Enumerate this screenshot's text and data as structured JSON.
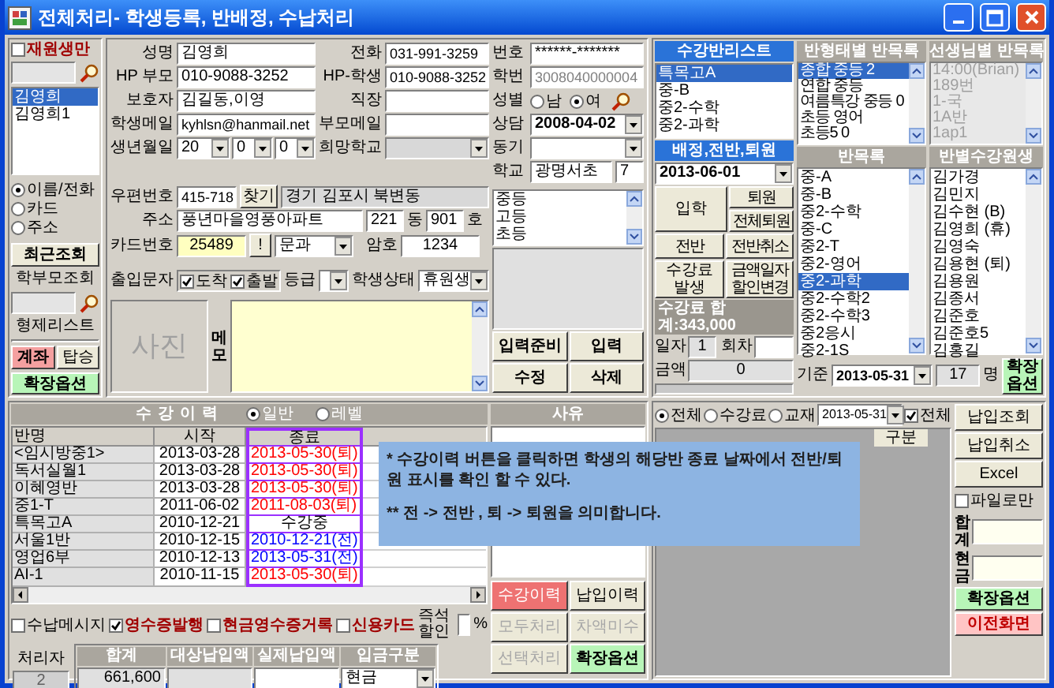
{
  "window": {
    "title": "전체처리- 학생등록, 반배정, 수납처리"
  },
  "sidebar": {
    "enrolled_only": {
      "label": "재원생만",
      "checked": false
    },
    "student_list": [
      {
        "label": "김영희",
        "selected": true
      },
      {
        "label": "김영희1",
        "selected": false
      }
    ],
    "search_modes": [
      {
        "label": "이름/전화",
        "selected": true
      },
      {
        "label": "카드",
        "selected": false
      },
      {
        "label": "주소",
        "selected": false
      }
    ],
    "recent_button": "최근조회",
    "parent_search_label": "학부모조회",
    "sibling_list_label": "형제리스트",
    "buttons": [
      {
        "label": "계좌",
        "kind": "accent"
      },
      {
        "label": "탑승",
        "kind": "plain"
      }
    ],
    "extend_button": "확장옵션"
  },
  "student_form": {
    "name": {
      "label": "성명",
      "value": "김영희"
    },
    "phone": {
      "label": "전화",
      "value": "031-991-3259"
    },
    "id_number": {
      "label": "번호",
      "value": "******-*******"
    },
    "parent_hp": {
      "label": "HP 부모",
      "value": "010-9088-3252"
    },
    "student_hp": {
      "label": "HP-학생",
      "value": "010-9088-3252"
    },
    "student_no": {
      "label": "학번",
      "value": "3008040000004",
      "disabled": true
    },
    "guardian": {
      "label": "보호자",
      "value": "김길동,이영"
    },
    "workplace": {
      "label": "직장"
    },
    "gender": {
      "label": "성별",
      "options": [
        {
          "label": "남",
          "selected": false
        },
        {
          "label": "여",
          "selected": true
        }
      ]
    },
    "student_email": {
      "label": "학생메일",
      "value": "kyhlsn@hanmail.net"
    },
    "parent_email": {
      "label": "부모메일"
    },
    "consult": {
      "label": "상담",
      "value": "2008-04-02"
    },
    "birth": {
      "label": "생년월일",
      "year": "20",
      "month": "0",
      "day": "0"
    },
    "desired_school": {
      "label": "희망학교"
    },
    "sibling": {
      "label": "동기"
    },
    "school": {
      "label": "학교",
      "value": "광명서초",
      "grade": "7"
    },
    "postal": {
      "label": "우편번호",
      "value": "415-718",
      "button": "찾기",
      "region": "경기 김포시 북변동"
    },
    "address": {
      "label": "주소",
      "value": "풍년마을영풍아파트",
      "building": "221",
      "building_label": "동",
      "unit": "901",
      "unit_label": "호"
    },
    "school_levels": [
      "중등",
      "고등",
      "초등"
    ],
    "card": {
      "label": "카드번호",
      "value": "25489",
      "button": "!",
      "track": "문과"
    },
    "password": {
      "label": "암호",
      "value": "1234"
    },
    "sms": {
      "label": "출입문자",
      "options": [
        {
          "label": "도착",
          "checked": true
        },
        {
          "label": "출발",
          "checked": true
        }
      ]
    },
    "grade": {
      "label": "등급"
    },
    "status": {
      "label": "학생상태",
      "value": "휴원생"
    },
    "photo_label": "사진",
    "memo_label": "메모",
    "buttons": [
      "입력준비",
      "입력",
      "수정",
      "삭제"
    ]
  },
  "class_list": {
    "title": "수강반리스트",
    "items": [
      {
        "label": "특목고A",
        "selected": true
      },
      {
        "label": "중-B",
        "selected": false
      },
      {
        "label": "중2-수학",
        "selected": false
      },
      {
        "label": "중2-과학",
        "selected": false
      }
    ]
  },
  "class_types": {
    "title": "반형태별 반목록",
    "items": [
      {
        "label": "종합 중등 2",
        "selected": true
      },
      {
        "label": "연합 중등",
        "selected": false
      },
      {
        "label": "여름특강 중등 0",
        "selected": false
      },
      {
        "label": "초등 영어",
        "selected": false
      },
      {
        "label": "초등5 0",
        "selected": false
      }
    ]
  },
  "teacher_classes": {
    "title": "선생님별 반목록",
    "disabled": true,
    "items": [
      "14:00(Brian)",
      "189번",
      "1-국",
      "1A반",
      "1ap1"
    ]
  },
  "assignment": {
    "title": "배정,전반,퇴원",
    "date": "2013-06-01",
    "enroll_button": "입학",
    "withdraw_buttons": [
      "퇴원",
      "전체퇴원"
    ],
    "buttons": [
      "전반",
      "전반취소",
      "수강료 발생",
      "금액일자 할인변경"
    ],
    "fee_total": "수강료 합계:343,000",
    "day_label": "일자",
    "day": "1",
    "round_label": "회차",
    "amount_label": "금액",
    "amount": "0"
  },
  "classes": {
    "title": "반목록",
    "items": [
      {
        "label": "중-A",
        "selected": false
      },
      {
        "label": "중-B",
        "selected": false
      },
      {
        "label": "중2-수학",
        "selected": false
      },
      {
        "label": "중-C",
        "selected": false
      },
      {
        "label": "중2-T",
        "selected": false
      },
      {
        "label": "중2-영어",
        "selected": false
      },
      {
        "label": "중2-과학",
        "selected": true
      },
      {
        "label": "중2-수학2",
        "selected": false
      },
      {
        "label": "중2-수학3",
        "selected": false
      },
      {
        "label": "중2응시",
        "selected": false
      },
      {
        "label": "중2-1S",
        "selected": false
      }
    ]
  },
  "class_students": {
    "title": "반별수강원생",
    "items": [
      "김가경",
      "김민지",
      "김수현 (B)",
      "김영희 (휴)",
      "김영숙",
      "김용현 (퇴)",
      "김용원",
      "김종서",
      "김준호",
      "김준호5",
      "김홍길"
    ],
    "base_label": "기준",
    "base_date": "2013-05-31",
    "count": "17",
    "count_unit": "명",
    "extend_button": "확장옵션"
  },
  "history": {
    "title": "수강이력",
    "modes": [
      {
        "label": "일반",
        "selected": true
      },
      {
        "label": "레벨",
        "selected": false
      }
    ],
    "reason_header": "사유",
    "columns": [
      "반명",
      "시작",
      "종료"
    ],
    "rows": [
      {
        "name": "<임시방중1>",
        "start": "2013-03-28",
        "end": "2013-05-30(퇴)",
        "kind": "withdrawn"
      },
      {
        "name": "독서실월1",
        "start": "2013-03-28",
        "end": "2013-05-30(퇴)",
        "kind": "withdrawn"
      },
      {
        "name": "이혜영반",
        "start": "2013-03-28",
        "end": "2013-05-30(퇴)",
        "kind": "withdrawn"
      },
      {
        "name": "중1-T",
        "start": "2011-06-02",
        "end": "2011-08-03(퇴)",
        "kind": "withdrawn"
      },
      {
        "name": "특목고A",
        "start": "2010-12-21",
        "end": "수강중",
        "kind": "ongoing"
      },
      {
        "name": "서울1반",
        "start": "2010-12-15",
        "end": "2010-12-21(전)",
        "kind": "transfer"
      },
      {
        "name": "영업6부",
        "start": "2010-12-13",
        "end": "2013-05-31(전)",
        "kind": "transfer"
      },
      {
        "name": "AI-1",
        "start": "2010-11-15",
        "end": "2013-05-30(퇴)",
        "kind": "withdrawn"
      }
    ],
    "notes": [
      "* 수강이력 버튼을 클릭하면 학생의 해당반 종료 날짜에서 전반/퇴원 표시를 확인 할 수 있다.",
      "** 전 -> 전반 , 퇴 -> 퇴원을 의미합니다."
    ]
  },
  "receipt_options": [
    {
      "label": "수납메시지",
      "checked": false,
      "kind": "plain"
    },
    {
      "label": "영수증발행",
      "checked": true,
      "kind": "emphasis"
    },
    {
      "label": "현금영수증거록",
      "checked": false,
      "kind": "emphasis"
    },
    {
      "label": "신용카드",
      "checked": false,
      "kind": "emphasis"
    }
  ],
  "discount": {
    "label": "즉석할인",
    "unit": "%"
  },
  "operator": {
    "label": "처리자",
    "value": "2"
  },
  "totals": {
    "columns": [
      "합계",
      "대상납입액",
      "실제납입액",
      "입금구분"
    ],
    "total": "661,600",
    "payment_type": "현금"
  },
  "action_buttons": [
    {
      "label": "수강이력",
      "kind": "active"
    },
    {
      "label": "납입이력",
      "kind": "plain"
    },
    {
      "label": "모두처리",
      "kind": "disabled"
    },
    {
      "label": "차액미수",
      "kind": "disabled"
    },
    {
      "label": "선택처리",
      "kind": "disabled"
    },
    {
      "label": "확장옵션",
      "kind": "green"
    }
  ],
  "payments": {
    "filters": [
      {
        "label": "전체",
        "selected": true
      },
      {
        "label": "수강료",
        "selected": false
      },
      {
        "label": "교재",
        "selected": false
      }
    ],
    "date": "2013-05-31",
    "all": {
      "label": "전체",
      "checked": true
    },
    "column": "구분",
    "buttons": [
      "납입조회",
      "납입취소",
      "Excel"
    ],
    "file_only": {
      "label": "파일로만",
      "checked": false
    },
    "sum_label": "합계",
    "cash_label": "현금",
    "extend_button": "확장옵션",
    "back_button": "이전화면"
  }
}
